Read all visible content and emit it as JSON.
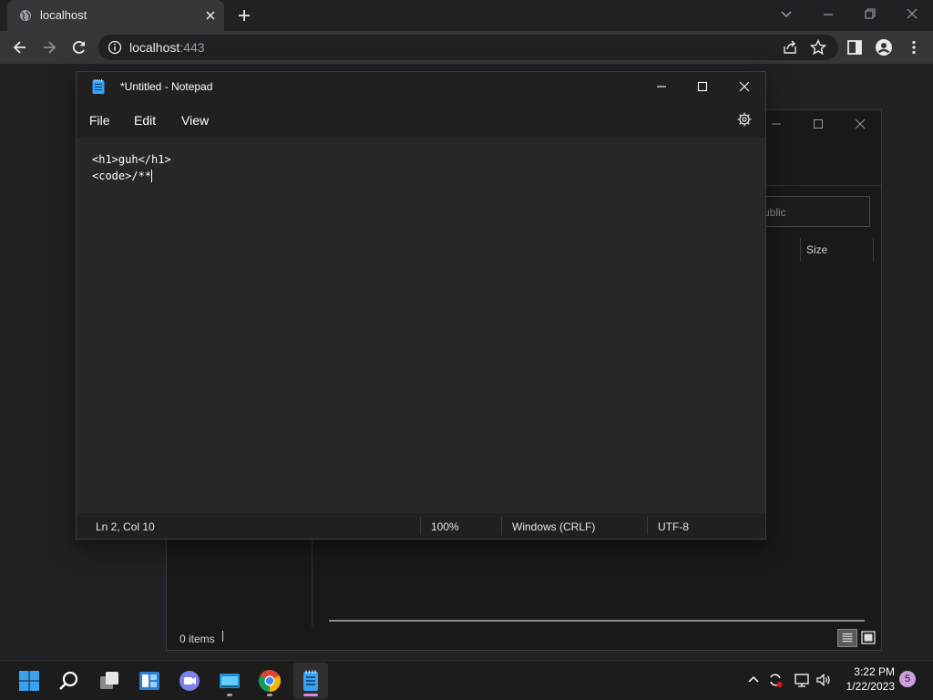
{
  "browser": {
    "tab": {
      "title": "localhost",
      "favicon": "globe-icon"
    },
    "address": {
      "host": "localhost",
      "port": ":443"
    },
    "toolbar_icons": [
      "back-arrow-icon",
      "forward-arrow-icon",
      "reload-icon",
      "site-info-icon",
      "share-icon",
      "star-icon",
      "sidebar-icon",
      "profile-icon",
      "kebab-menu-icon"
    ]
  },
  "explorer": {
    "search_placeholder": "ublic",
    "column_size": "Size",
    "status_items": "0 items"
  },
  "notepad": {
    "title": "*Untitled - Notepad",
    "menu": {
      "file": "File",
      "edit": "Edit",
      "view": "View"
    },
    "content": {
      "line1": "<h1>guh</h1>",
      "line2": "<code>/**"
    },
    "status": {
      "position": "Ln 2, Col 10",
      "zoom": "100%",
      "line_ending": "Windows (CRLF)",
      "encoding": "UTF-8"
    }
  },
  "taskbar": {
    "apps": [
      "windows-start-icon",
      "search-icon",
      "task-view-icon",
      "widgets-icon",
      "teams-chat-icon",
      "file-explorer-icon",
      "chrome-icon",
      "notepad-icon"
    ],
    "clock": {
      "time": "3:22 PM",
      "date": "1/22/2023"
    },
    "notification_count": "5"
  },
  "colors": {
    "chrome_bg": "#202124",
    "chrome_toolbar": "#35363a",
    "notepad_bg": "#272727",
    "taskbar_bg": "#1c1c1c",
    "accent_win": "#3aa0f0"
  }
}
